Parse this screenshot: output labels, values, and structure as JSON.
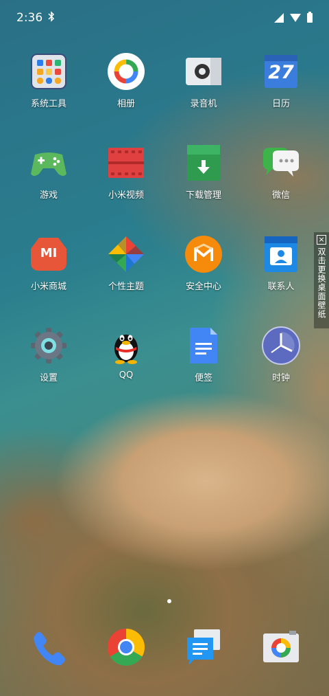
{
  "status": {
    "time": "2:36",
    "bluetooth_icon": "bluetooth-icon"
  },
  "apps": [
    {
      "label": "系统工具",
      "icon": "system-tools-folder-icon"
    },
    {
      "label": "相册",
      "icon": "photos-icon"
    },
    {
      "label": "录音机",
      "icon": "recorder-icon"
    },
    {
      "label": "日历",
      "icon": "calendar-icon",
      "date": "27"
    },
    {
      "label": "游戏",
      "icon": "games-icon"
    },
    {
      "label": "小米视频",
      "icon": "mi-video-icon"
    },
    {
      "label": "下载管理",
      "icon": "download-manager-icon"
    },
    {
      "label": "微信",
      "icon": "wechat-icon"
    },
    {
      "label": "小米商城",
      "icon": "mi-store-icon",
      "glyph": "MI"
    },
    {
      "label": "个性主题",
      "icon": "themes-icon"
    },
    {
      "label": "安全中心",
      "icon": "security-center-icon"
    },
    {
      "label": "联系人",
      "icon": "contacts-icon"
    },
    {
      "label": "设置",
      "icon": "settings-gear-icon"
    },
    {
      "label": "QQ",
      "icon": "qq-penguin-icon"
    },
    {
      "label": "便签",
      "icon": "notes-icon"
    },
    {
      "label": "时钟",
      "icon": "clock-icon"
    }
  ],
  "side_banner": {
    "text": "双击更换桌面壁纸",
    "close": "×"
  },
  "dock": [
    {
      "icon": "phone-icon"
    },
    {
      "icon": "chrome-icon"
    },
    {
      "icon": "messages-icon"
    },
    {
      "icon": "camera-icon"
    }
  ],
  "colors": {
    "accent_blue": "#4285f4",
    "accent_red": "#ea4335",
    "accent_green": "#34a853",
    "accent_yellow": "#fbbc05"
  }
}
